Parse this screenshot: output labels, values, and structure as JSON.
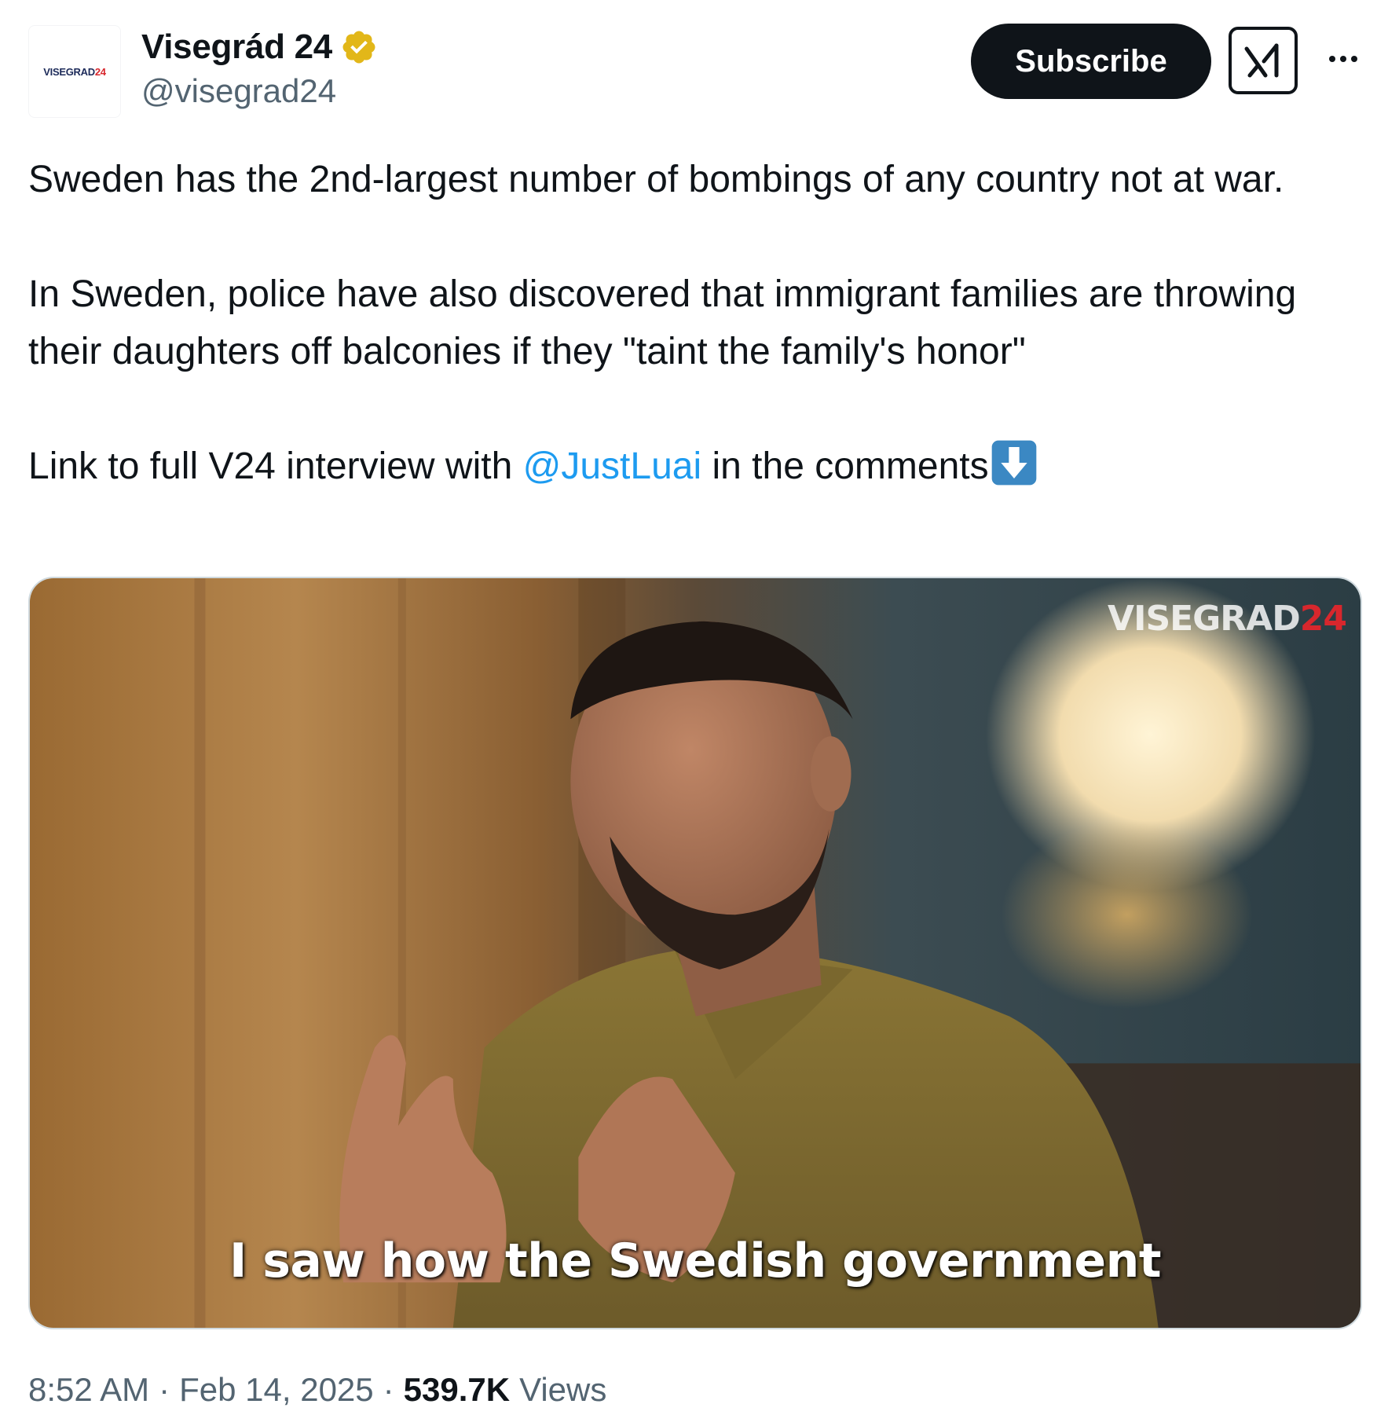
{
  "author": {
    "display_name": "Visegrád 24",
    "handle": "@visegrad24",
    "avatar_logo_text": "VISEGRAD",
    "avatar_logo_num": "24",
    "verified_badge_color": "#e2b719"
  },
  "actions": {
    "subscribe_label": "Subscribe",
    "grok_icon": "grok-icon",
    "more_icon": "more-icon"
  },
  "tweet": {
    "paragraph_1": "Sweden has the 2nd-largest number of bombings of any country not at war.",
    "paragraph_2": "In Sweden, police have also discovered that immigrant families are throwing their daughters off balconies if they \"taint the family's honor\"",
    "paragraph_3_prefix": "Link to full V24 interview with ",
    "mention": "@JustLuai",
    "paragraph_3_suffix": " in the comments",
    "emoji": "down-arrow-emoji"
  },
  "media": {
    "type": "video",
    "watermark_text": "VISEGRAD",
    "watermark_num": "24",
    "caption": "I saw how the Swedish government"
  },
  "meta": {
    "time": "8:52 AM",
    "separator": "·",
    "date": "Feb 14, 2025",
    "views_count": "539.7K",
    "views_label": "Views"
  },
  "colors": {
    "text": "#0f1419",
    "secondary": "#536471",
    "link": "#1d9bf0",
    "brand_red": "#d8272d",
    "brand_navy": "#1d2b5a"
  }
}
